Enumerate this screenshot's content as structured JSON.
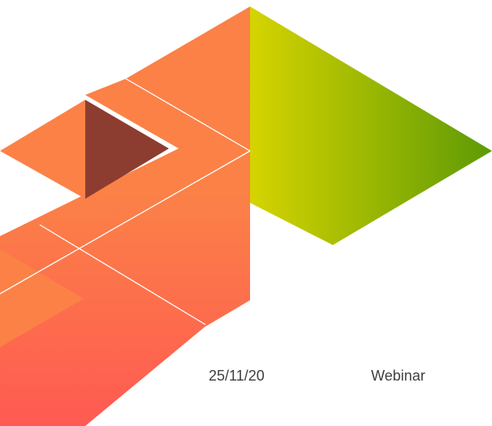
{
  "slide": {
    "date": "25/11/20",
    "event_type": "Webinar"
  },
  "colors": {
    "background": "#ffffff",
    "orange": "#fb8147",
    "coral": "#ff5a52",
    "dark_triangle": "#8c3d30",
    "green_light": "#d6d400",
    "green_dark": "#5d9a05",
    "text": "#3f3f3f"
  }
}
